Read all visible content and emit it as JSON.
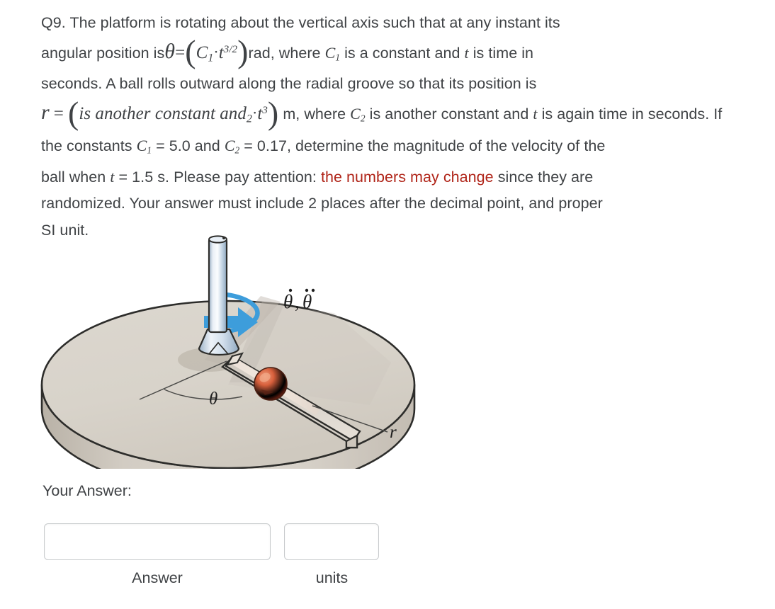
{
  "question": {
    "number": "Q9.",
    "lines": [
      "Q9. The platform is rotating about the vertical axis such that at any instant its",
      "angular position is θ = (C₁ · t^{3/2}) rad, where C₁ is a constant and t is time in",
      "seconds. A ball rolls outward along the radial groove so that its position is",
      "r = (C₂ · t³) m, where C₂ is another constant and t is again time in seconds. If",
      "the constants C₁ = 5.0 and C₂ = 0.17, determine the magnitude of the velocity of the",
      "ball when t = 1.5 s. Please pay attention: the numbers may change since they are",
      "randomized. Your answer must include 2 places after the decimal point, and proper",
      "SI unit."
    ],
    "seg": {
      "l1_a": "Q9. The platform is rotating about the vertical axis such that at any instant its",
      "l2_a": "angular position is",
      "l2_theta": "θ",
      "l2_eq": "=",
      "l2_c": "C",
      "l2_c_sub": "1",
      "l2_dot": "·",
      "l2_t": "t",
      "l2_t_sup": "3/2",
      "l2_b": "rad, where",
      "l2_c2": "C",
      "l2_c2_sub": "1",
      "l2_d": "is a constant and",
      "l2_t2": "t",
      "l2_e": "is time in",
      "l3_a": "seconds. A ball rolls outward along the radial groove so that its position is",
      "l4_r": "r",
      "l4_eq": "=",
      "l4_c": "is another constant and",
      "l4_c_sub": "2",
      "l4_dot": "·",
      "l4_t": "t",
      "l4_t_sup": "3",
      "l4_b": "m, where",
      "l4_c2": "C",
      "l4_c2_sub": "2",
      "l4_t2": "t",
      "l4_d": "is again time in seconds. If",
      "l5_a": "the constants",
      "l5_c1": "C",
      "l5_c1_sub": "1",
      "l5_v1": "= 5.0 and",
      "l5_c2": "C",
      "l5_c2_sub": "2",
      "l5_v2": "= 0.17, determine the magnitude of the velocity of the",
      "l6_a": "ball when",
      "l6_t": "t",
      "l6_v": "= 1.5 s. Please pay attention:",
      "l6_warn": "the numbers may change",
      "l6_b": "since they are",
      "l7_a": "randomized. Your answer must include 2 places after the decimal point, and proper",
      "l8_a": "SI unit."
    },
    "constants": {
      "C1": "5.0",
      "C2": "0.17",
      "t": "1.5",
      "t_unit": "s",
      "theta_exponent": "3/2",
      "r_exponent": "3",
      "theta_unit": "rad",
      "r_unit": "m",
      "decimal_places": "2"
    },
    "warn_color": "#b02418",
    "text_color": "#3f4245"
  },
  "figure": {
    "name": "rotating-platform-with-radial-groove",
    "labels": {
      "theta_rates": "θ̇, θ̈",
      "theta": "θ",
      "radius": "r"
    },
    "colors": {
      "platform_top": "#d9d4cc",
      "platform_side": "#c9c2b8",
      "platform_outline": "#2d2d2b",
      "shaft_light": "#eef2f7",
      "shaft_mid": "#b9cbdd",
      "shaft_dark": "#8fa9c2",
      "arrow_blue": "#3d9ddb",
      "ball_red": "#c2402b",
      "ball_highlight": "#e88a6c",
      "groove_inner": "#e8ddd4",
      "shadow": "#bdb5ac"
    }
  },
  "answer_section": {
    "label": "Your Answer:",
    "answer_field": {
      "value": "",
      "placeholder": "",
      "caption": "Answer"
    },
    "units_field": {
      "value": "",
      "placeholder": "",
      "caption": "units"
    }
  }
}
